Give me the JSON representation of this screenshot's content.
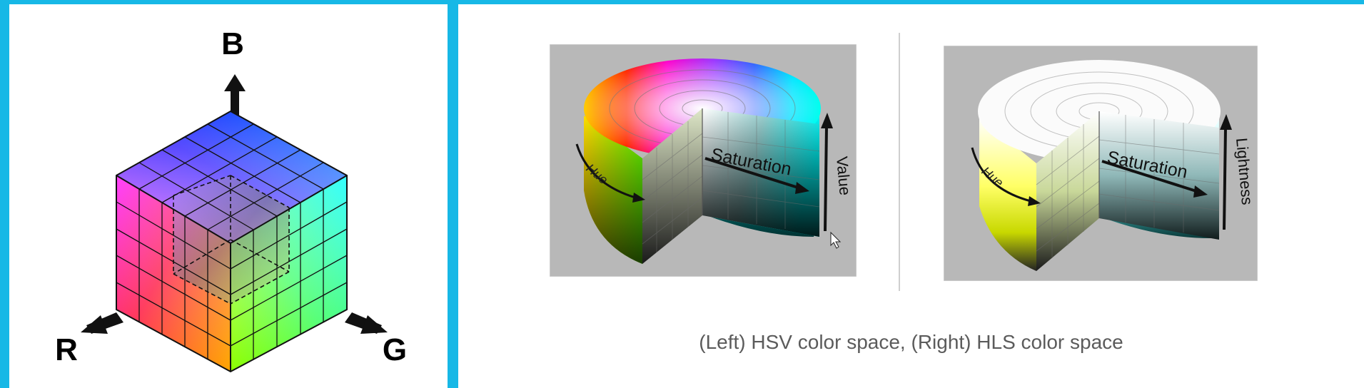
{
  "rgb_cube": {
    "label_b": "B",
    "label_r": "R",
    "label_g": "G"
  },
  "hsv": {
    "hue_label": "Hue",
    "saturation_label": "Saturation",
    "value_label": "Value"
  },
  "hls": {
    "hue_label": "Hue",
    "saturation_label": "Saturation",
    "lightness_label": "Lightness"
  },
  "caption": "(Left) HSV color space, (Right) HLS color space",
  "colors": {
    "frame": "#17b8e6",
    "panel_bg": "#ffffff",
    "figure_bg": "#b8b8b8",
    "caption_text": "#5b5b5b"
  }
}
